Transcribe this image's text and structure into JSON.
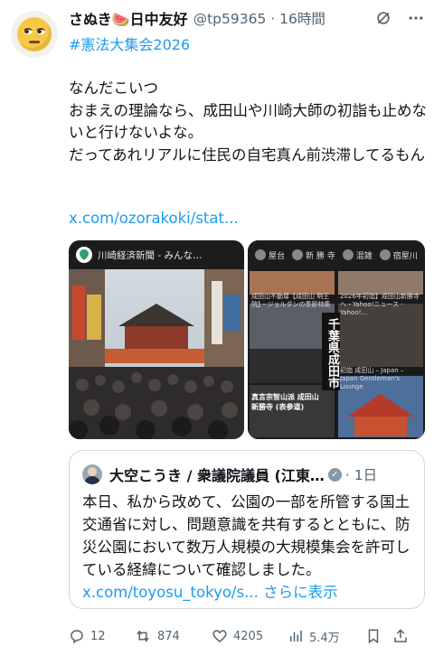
{
  "tweet": {
    "author_name": "さぬき🍉日中友好",
    "handle_time": "@tp59365 · 16時間",
    "hashtag": "#憲法大集会2026",
    "text": "なんだこいつ\nおまえの理論なら、成田山や川崎大師の初詣も止めないと行けないよな。\nだってあれリアルに住民の自宅真ん前渋滞してるもん",
    "link": "x.com/ozorakoki/stat..."
  },
  "media": {
    "left_card_title": "川崎経済新聞 - みんな…",
    "right_card_pills": [
      "屋台",
      "新 勝 寺",
      "混雑",
      "宿屋川"
    ],
    "right_card_snippets": [
      "成田山不動尊【成田山 明王院】・ジョルダンの季節特集",
      "2026年初詣】成田山新勝寺へ・Yahoo!ニュース - Yahoo!…",
      "初詣 成田山 – Japan – Japan Gentleman's Lounge"
    ],
    "right_card_overlay_vertical": "千葉県成田市",
    "right_card_overlay_caption": "真言宗智山派 成田山新勝寺 (表参道)"
  },
  "quote": {
    "name": "大空こうき / 衆議院議員 (江東…",
    "time": "· 1日",
    "text": "本日、私から改めて、公園の一部を所管する国土交通省に対し、問題意識を共有するとともに、防災公園において数万人規模の大規模集会を許可している経緯について確認しました。",
    "link": "x.com/toyosu_tokyo/s...",
    "more": "さらに表示"
  },
  "actions": {
    "replies": "12",
    "reposts": "874",
    "likes": "4205",
    "views": "5.4万"
  },
  "colors": {
    "link": "#1d9bf0",
    "secondary": "#536471",
    "border": "#cfd9de"
  }
}
